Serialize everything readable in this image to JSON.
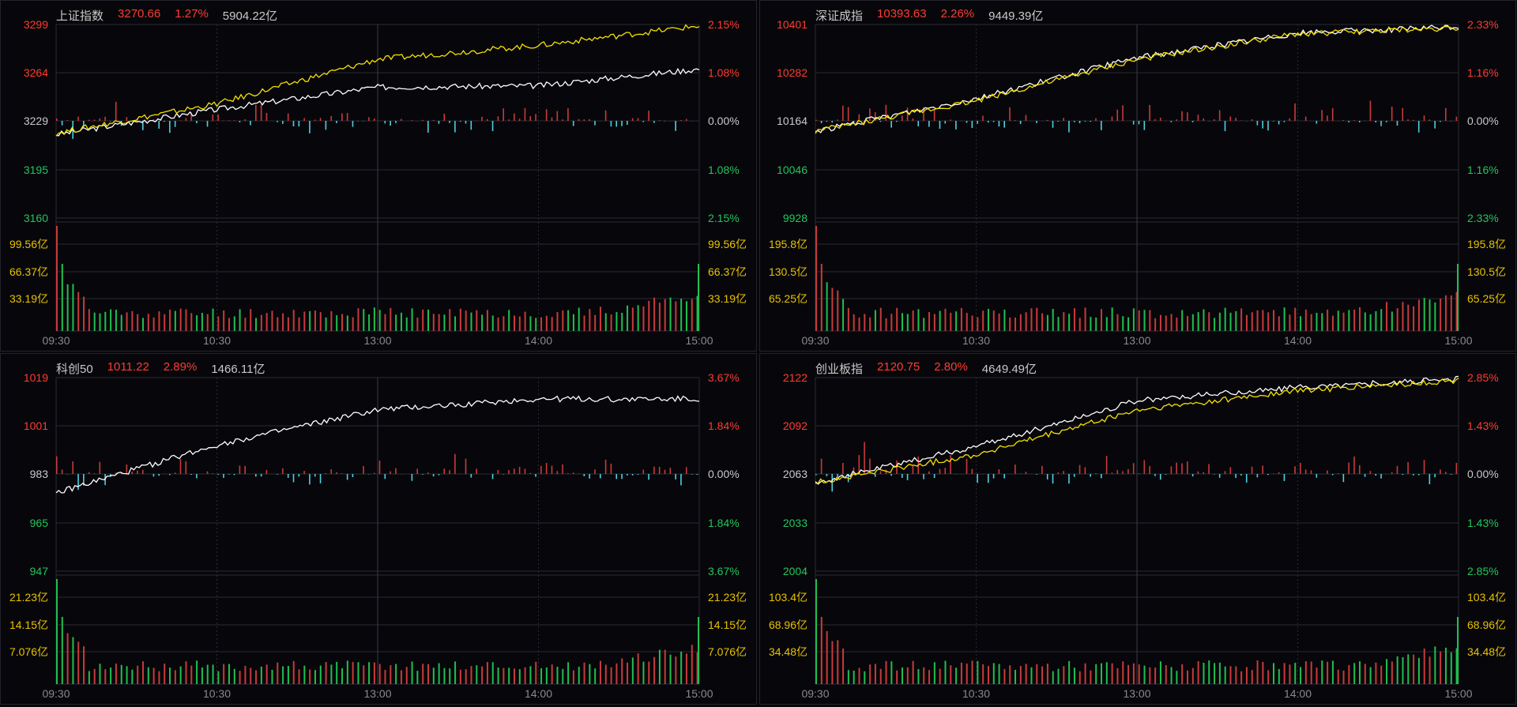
{
  "panels": [
    {
      "name": "上证指数",
      "value": "3270.66",
      "change_pct": "1.27%",
      "amount": "5904.22亿",
      "price_ticks": [
        "3299",
        "3264",
        "3229",
        "3195",
        "3160"
      ],
      "pct_ticks": [
        "2.15%",
        "1.08%",
        "0.00%",
        "1.08%",
        "2.15%"
      ],
      "vol_ticks": [
        "99.56亿",
        "66.37亿",
        "33.19亿"
      ],
      "time_ticks": [
        "09:30",
        "10:30",
        "13:00",
        "14:00",
        "15:00"
      ],
      "has_yellow": true
    },
    {
      "name": "深证成指",
      "value": "10393.63",
      "change_pct": "2.26%",
      "amount": "9449.39亿",
      "price_ticks": [
        "10401",
        "10282",
        "10164",
        "10046",
        "9928"
      ],
      "pct_ticks": [
        "2.33%",
        "1.16%",
        "0.00%",
        "1.16%",
        "2.33%"
      ],
      "vol_ticks": [
        "195.8亿",
        "130.5亿",
        "65.25亿"
      ],
      "time_ticks": [
        "09:30",
        "10:30",
        "13:00",
        "14:00",
        "15:00"
      ],
      "has_yellow": true
    },
    {
      "name": "科创50",
      "value": "1011.22",
      "change_pct": "2.89%",
      "amount": "1466.11亿",
      "price_ticks": [
        "1019",
        "1001",
        "983",
        "965",
        "947"
      ],
      "pct_ticks": [
        "3.67%",
        "1.84%",
        "0.00%",
        "1.84%",
        "3.67%"
      ],
      "vol_ticks": [
        "21.23亿",
        "14.15亿",
        "7.076亿"
      ],
      "time_ticks": [
        "09:30",
        "10:30",
        "13:00",
        "14:00",
        "15:00"
      ],
      "has_yellow": false
    },
    {
      "name": "创业板指",
      "value": "2120.75",
      "change_pct": "2.80%",
      "amount": "4649.49亿",
      "price_ticks": [
        "2122",
        "2092",
        "2063",
        "2033",
        "2004"
      ],
      "pct_ticks": [
        "2.85%",
        "1.43%",
        "0.00%",
        "1.43%",
        "2.85%"
      ],
      "vol_ticks": [
        "103.4亿",
        "68.96亿",
        "34.48亿"
      ],
      "time_ticks": [
        "09:30",
        "10:30",
        "13:00",
        "14:00",
        "15:00"
      ],
      "has_yellow": true
    }
  ],
  "colors": {
    "up": "#ff3b30",
    "down": "#22c55e",
    "neutral": "#c9c9c9",
    "volume_label": "#e8c200",
    "price_line": "#ffffff",
    "avg_line": "#f5e000",
    "bar_up": "#c83a3a",
    "bar_down": "#4dd0e1",
    "vol_up": "#c83a3a",
    "vol_down": "#1fbf4f",
    "grid": "#2a2a33"
  },
  "chart_data": [
    {
      "type": "line",
      "title": "上证指数",
      "x": [
        "09:30",
        "10:30",
        "13:00",
        "14:00",
        "15:00"
      ],
      "ylim": [
        3160,
        3299
      ],
      "series": [
        {
          "name": "",
          "values": [
            3220,
            3238,
            3254,
            3255,
            3267
          ]
        },
        {
          "name": "",
          "values": [
            3221,
            3242,
            3274,
            3284,
            3298
          ]
        }
      ]
    },
    {
      "type": "line",
      "title": "深证成指",
      "x": [
        "09:30",
        "10:30",
        "13:00",
        "14:00",
        "15:00"
      ],
      "ylim": [
        9928,
        10401
      ],
      "series": [
        {
          "name": "",
          "values": [
            10140,
            10220,
            10320,
            10380,
            10395
          ]
        },
        {
          "name": "",
          "values": [
            10140,
            10215,
            10315,
            10378,
            10393
          ]
        }
      ]
    },
    {
      "type": "line",
      "title": "科创50",
      "x": [
        "09:30",
        "10:30",
        "13:00",
        "14:00",
        "15:00"
      ],
      "ylim": [
        947,
        1019
      ],
      "series": [
        {
          "name": "",
          "values": [
            976,
            994,
            1007,
            1011,
            1011
          ]
        }
      ]
    },
    {
      "type": "line",
      "title": "创业板指",
      "x": [
        "09:30",
        "10:30",
        "13:00",
        "14:00",
        "15:00"
      ],
      "ylim": [
        2004,
        2122
      ],
      "series": [
        {
          "name": "",
          "values": [
            2058,
            2080,
            2108,
            2116,
            2121
          ]
        },
        {
          "name": "",
          "values": [
            2058,
            2075,
            2102,
            2114,
            2120
          ]
        }
      ]
    }
  ]
}
